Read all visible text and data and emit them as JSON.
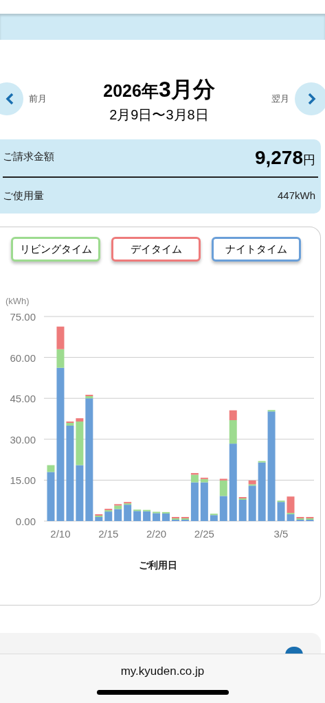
{
  "period": {
    "prev_label": "前月",
    "year": "2026年",
    "month": "3月分",
    "range": "2月9日〜3月8日",
    "next_label": "翌月"
  },
  "summary": {
    "amount_label": "ご請求金額",
    "amount": "9,278",
    "amount_unit": "円",
    "usage_label": "ご使用量",
    "usage": "447kWh"
  },
  "chart": {
    "chart_data": {
      "type": "bar",
      "stacked": true,
      "grid": true,
      "xlabel": "ご利用日",
      "ylabel": "(kWh)",
      "ylim": [
        0,
        75
      ],
      "yticks": [
        {
          "value": 0,
          "label": "0.00"
        },
        {
          "value": 15,
          "label": "15.00"
        },
        {
          "value": 30,
          "label": "30.00"
        },
        {
          "value": 45,
          "label": "45.00"
        },
        {
          "value": 60,
          "label": "60.00"
        },
        {
          "value": 75,
          "label": "75.00"
        }
      ],
      "categories": [
        null,
        "2/10",
        null,
        null,
        null,
        null,
        "2/15",
        null,
        null,
        null,
        null,
        "2/20",
        null,
        null,
        null,
        null,
        "2/25",
        null,
        null,
        null,
        null,
        null,
        null,
        null,
        "3/5",
        null,
        null,
        null
      ],
      "series": [
        {
          "name": "リビングタイム",
          "color": "#9ddb8f",
          "values": [
            2.5,
            6.8,
            1,
            16,
            0.8,
            0.5,
            0.5,
            1.3,
            0.5,
            0.5,
            0.5,
            0.5,
            0.5,
            0.5,
            0.5,
            2.8,
            1.2,
            0.5,
            5.7,
            8.6,
            0.5,
            0.5,
            0.5,
            0.5,
            0.5,
            0.5,
            0.5,
            0.5
          ]
        },
        {
          "name": "デイタイム",
          "color": "#ee7b7b",
          "values": [
            0,
            8.3,
            0.5,
            1.2,
            0.5,
            0.5,
            0.5,
            0.5,
            0.5,
            0,
            0,
            0,
            0,
            0.5,
            0.5,
            0.6,
            0.5,
            0,
            0.6,
            3.6,
            0.5,
            1.4,
            0,
            0,
            0,
            6,
            0.5,
            0.5
          ]
        },
        {
          "name": "ナイトタイム",
          "color": "#6a9fd8",
          "values": [
            18,
            56.2,
            35,
            20.5,
            45,
            1.5,
            3.5,
            4.4,
            6,
            3.7,
            3.6,
            2.9,
            2.8,
            0.5,
            0.5,
            14.2,
            14.2,
            2.2,
            9.2,
            28.4,
            7.8,
            13,
            21.5,
            40.2,
            7,
            2.5,
            0.5,
            0.5
          ]
        }
      ]
    }
  },
  "browser_bar": {
    "url": "my.kyuden.co.jp"
  }
}
